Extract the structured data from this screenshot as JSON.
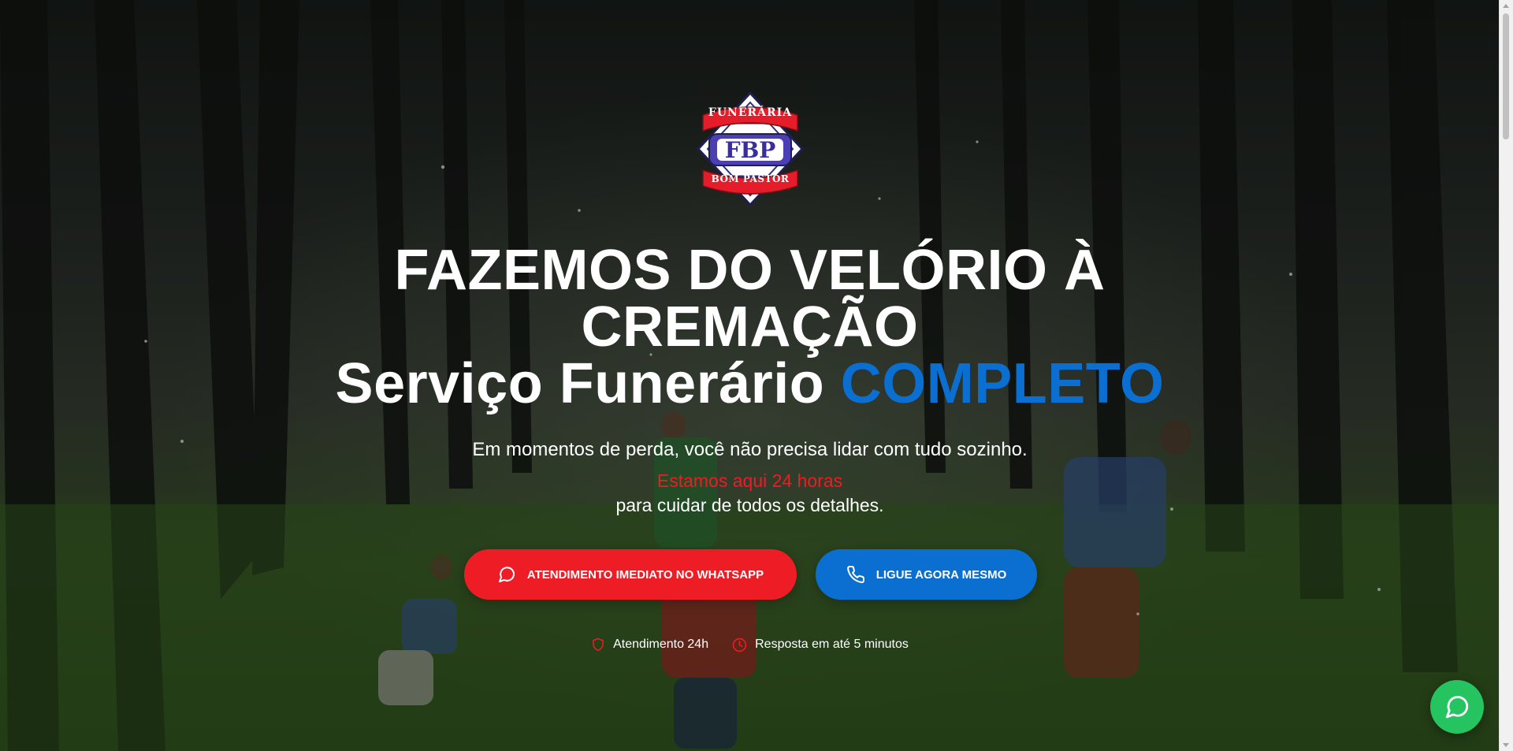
{
  "brand": {
    "logo_top_text": "FUNERÁRIA",
    "logo_center_text": "FBP",
    "logo_bottom_text": "BOM PASTOR"
  },
  "hero": {
    "headline_line1": "FAZEMOS DO VELÓRIO À",
    "headline_line2": "CREMAÇÃO",
    "headline_line3_prefix": "Serviço Funerário ",
    "headline_line3_accent": "COMPLETO",
    "subtitle": "Em momentos de perda, você não precisa lidar com tudo sozinho.",
    "highlight": "Estamos aqui 24 horas",
    "subtitle2": "para cuidar de todos os detalhes."
  },
  "buttons": {
    "whatsapp_label": "ATENDIMENTO IMEDIATO NO WHATSAPP",
    "call_label": "LIGUE AGORA MESMO"
  },
  "badges": [
    {
      "icon": "shield-icon",
      "label": "Atendimento 24h"
    },
    {
      "icon": "clock-icon",
      "label": "Resposta em até 5 minutos"
    }
  ],
  "floating": {
    "icon": "whatsapp-icon"
  },
  "colors": {
    "accent_blue": "#0a6fd1",
    "accent_red": "#ee1c25",
    "whatsapp_green": "#25c460"
  }
}
